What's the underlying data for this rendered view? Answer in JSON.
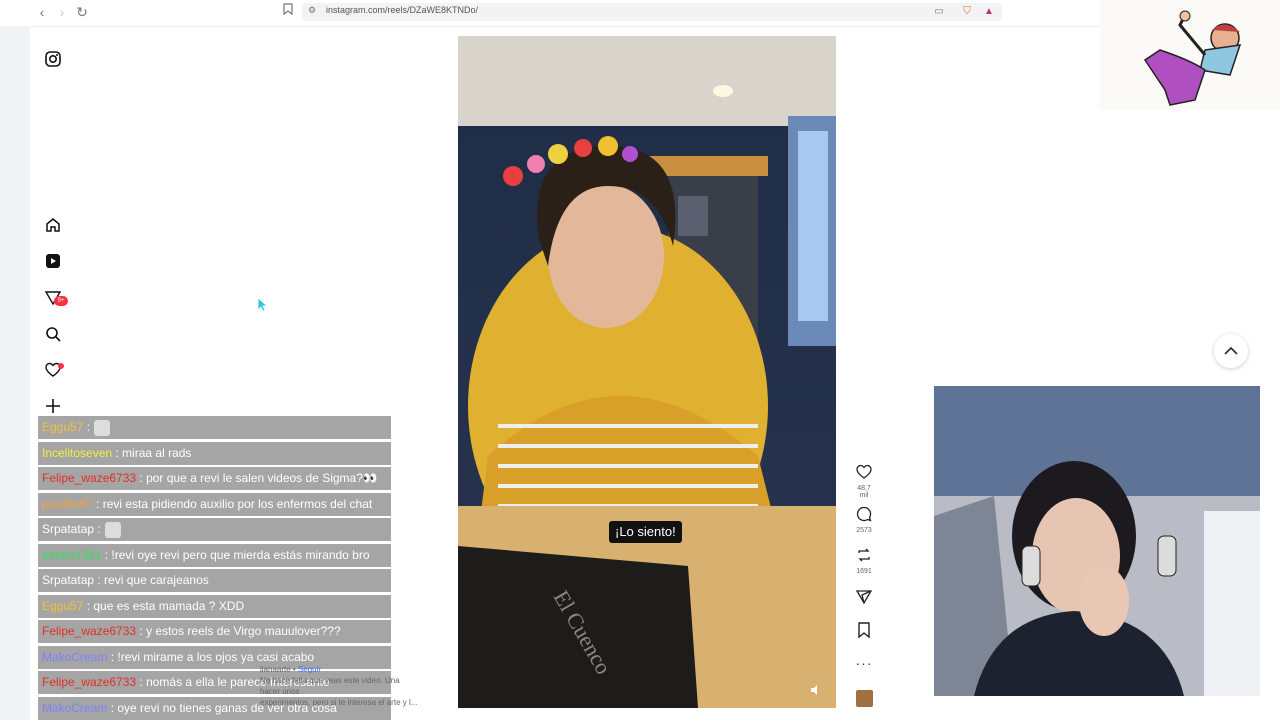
{
  "browser": {
    "url": "instagram.com/reels/DZaWE8KTNDo/",
    "back": "‹",
    "forward": "›",
    "reload": "↻"
  },
  "sidebar": {
    "notifications_badge": "9+"
  },
  "video": {
    "subtitle": "¡Lo siento!"
  },
  "actions": {
    "likes": "48,7 mil",
    "comments": "2573",
    "reposts": "1691"
  },
  "caption": {
    "author": "ilanaarte",
    "follow": "Seguir",
    "line1": "No hace falta que veas este video. Una",
    "line2": "hacer unos",
    "line3": "experimentos, pero si te interesa el arte y l..."
  },
  "chat": [
    {
      "user": "Eggu57",
      "color": "#f0c040",
      "text": " :",
      "emote": true
    },
    {
      "user": "Incelitoseven",
      "color": "#f0f040",
      "text": " : miraa al rads"
    },
    {
      "user": "Felipe_waze6733",
      "color": "#e0302a",
      "text": " : por que a revi le salen videos de Sigma?👀"
    },
    {
      "user": "pixulita67",
      "color": "#f0a040",
      "text": " : revi esta pidiendo auxilio por los enfermos del chat"
    },
    {
      "user": "Srpatatap",
      "color": "#ffffff",
      "text": " :",
      "emote": true
    },
    {
      "user": "elmen1391",
      "color": "#30e060",
      "text": " : !revi oye revi pero que mierda estás mirando bro"
    },
    {
      "user": "Srpatatap",
      "color": "#ffffff",
      "text": " : revi que carajeanos"
    },
    {
      "user": "Eggu57",
      "color": "#f0c040",
      "text": " : que es esta mamada ? XDD"
    },
    {
      "user": "Felipe_waze6733",
      "color": "#e0302a",
      "text": " : y estos reels de Virgo mauulover???"
    },
    {
      "user": "MakoCream",
      "color": "#8080ff",
      "text": " : !revi mirame a los ojos ya casi acabo"
    },
    {
      "user": "Felipe_waze6733",
      "color": "#e0302a",
      "text": " : nomás a ella le parece interesante"
    },
    {
      "user": "MakoCream",
      "color": "#8080ff",
      "text": " : oye revi no tienes ganas de ver otra cosa"
    }
  ]
}
